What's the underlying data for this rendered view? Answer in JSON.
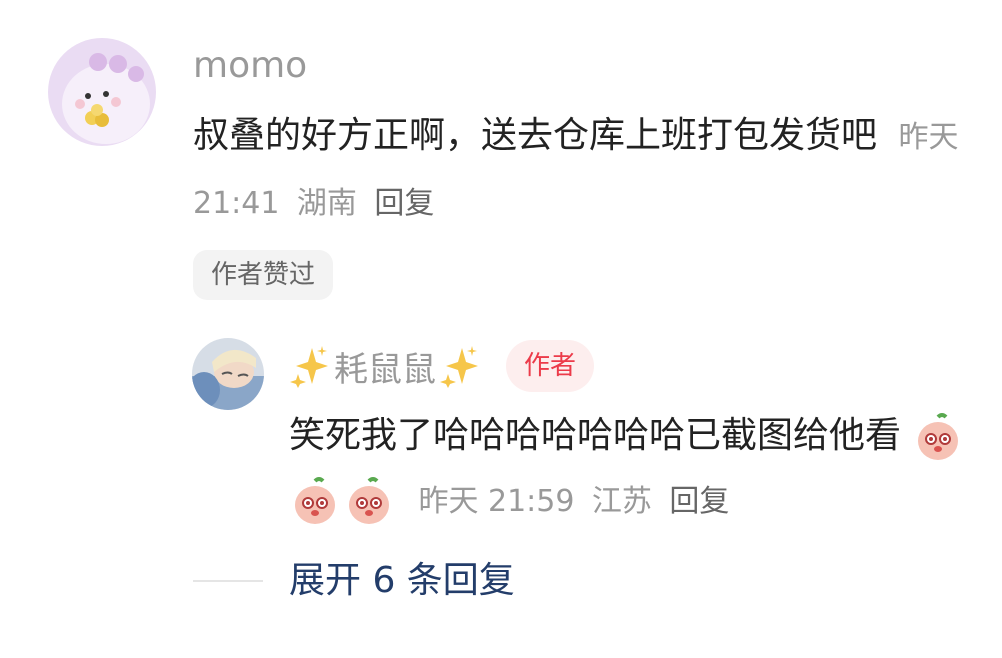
{
  "comment": {
    "username": "momo",
    "text": "叔叠的好方正啊，送去仓库上班打包发货吧",
    "time": "昨天 21:41",
    "location": "湖南",
    "reply_label": "回复",
    "liked_badge": "作者赞过"
  },
  "reply": {
    "username": "耗鼠鼠",
    "author_badge": "作者",
    "text": "笑死我了哈哈哈哈哈哈哈已截图给他看",
    "emojis": [
      "peach-face-emoji",
      "peach-face-emoji",
      "peach-face-emoji"
    ],
    "time": "昨天 21:59",
    "location": "江苏",
    "reply_label": "回复"
  },
  "expand_label": "展开 6 条回复",
  "colors": {
    "text": "#222222",
    "meta": "#999999",
    "author_badge_bg": "#fdeeee",
    "author_badge_text": "#ec3b4a",
    "expand_link": "#233d6a"
  }
}
